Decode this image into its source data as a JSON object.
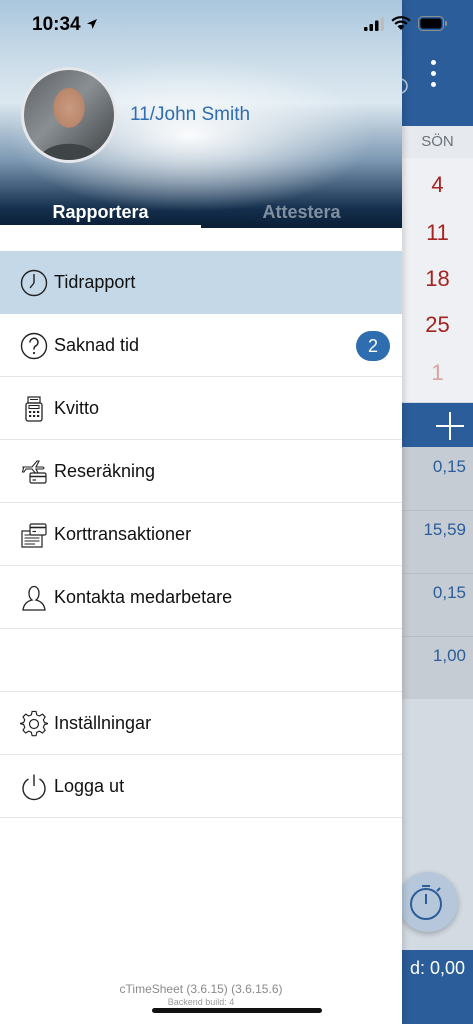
{
  "status_bar": {
    "time": "10:34"
  },
  "background": {
    "day_header": "SÖN",
    "dates": [
      "4",
      "11",
      "18",
      "25",
      "1"
    ],
    "values": [
      "0,15",
      "15,59",
      "0,15",
      "1,00"
    ],
    "footer_text": "d: 0,00",
    "colors": {
      "primary": "#2b5d9a",
      "date_red": "#a42422"
    }
  },
  "drawer": {
    "user_name": "11/John Smith",
    "tabs": [
      {
        "label": "Rapportera",
        "selected": true
      },
      {
        "label": "Attestera",
        "selected": false
      }
    ],
    "menu": [
      {
        "label": "Tidrapport",
        "icon": "clock-icon",
        "active": true
      },
      {
        "label": "Saknad tid",
        "icon": "question-icon",
        "badge": "2"
      },
      {
        "label": "Kvitto",
        "icon": "receipt-icon"
      },
      {
        "label": "Reseräkning",
        "icon": "travel-expense-icon"
      },
      {
        "label": "Korttransaktioner",
        "icon": "card-transactions-icon"
      },
      {
        "label": "Kontakta medarbetare",
        "icon": "person-icon"
      },
      {
        "label": "Inställningar",
        "icon": "gear-icon"
      },
      {
        "label": "Logga ut",
        "icon": "power-icon"
      }
    ],
    "version": "cTimeSheet (3.6.15) (3.6.15.6)",
    "build": "Backend build: 4",
    "colors": {
      "accent": "#2e6db0",
      "active_row": "#c5d8e8"
    }
  }
}
